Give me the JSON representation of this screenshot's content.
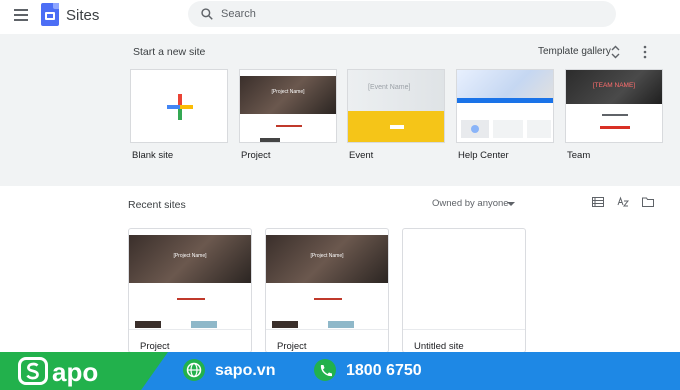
{
  "app": {
    "title": "Sites"
  },
  "search": {
    "placeholder": "Search"
  },
  "gallery": {
    "heading": "Start a new site",
    "gallery_link": "Template gallery",
    "templates": [
      {
        "label": "Blank site"
      },
      {
        "label": "Project",
        "preview_title": "[Project Name]"
      },
      {
        "label": "Event",
        "preview_title": "[Event Name]"
      },
      {
        "label": "Help Center"
      },
      {
        "label": "Team",
        "preview_title": "[TEAM NAME]"
      }
    ]
  },
  "recent": {
    "heading": "Recent sites",
    "filter": "Owned by anyone",
    "sites": [
      {
        "label": "Project",
        "preview_title": "[Project Name]"
      },
      {
        "label": "Project",
        "preview_title": "[Project Name]"
      },
      {
        "label": "Untitled site"
      }
    ]
  },
  "banner": {
    "brand": "apo",
    "website": "sapo.vn",
    "phone": "1800 6750"
  },
  "colors": {
    "accent": "#4c6ef5",
    "banner_green": "#22b14c",
    "banner_blue": "#1e88e5"
  }
}
